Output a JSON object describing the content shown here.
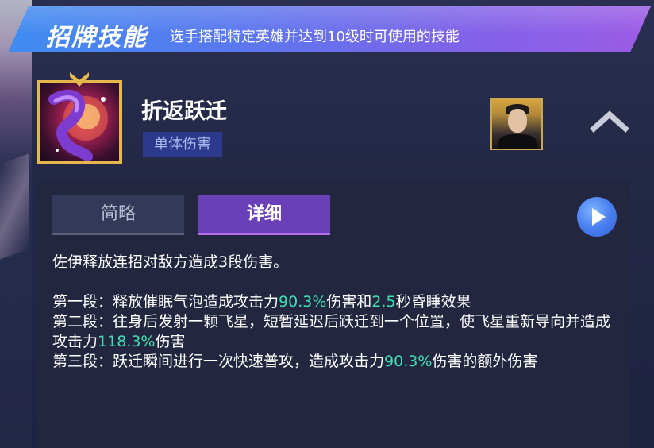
{
  "banner": {
    "title": "招牌技能",
    "subtitle": "选手搭配特定英雄并达到10级时可使用的技能"
  },
  "skill": {
    "icon": "skill-icon-purple-swirl",
    "name": "折返跃迁",
    "tag": "单体伤害"
  },
  "hero_avatar": "player-avatar",
  "collapse_icon": "chevron-up-icon",
  "tabs": [
    {
      "label": "简略",
      "active": false
    },
    {
      "label": "详细",
      "active": true
    }
  ],
  "play_icon": "play-icon",
  "colors": {
    "highlight": "#3ee0b4",
    "active_tab": "#6a40b8",
    "banner_start": "#3f8cf0",
    "banner_end": "#9c5be6"
  },
  "description": {
    "intro": "佐伊释放连招对敌方造成3段伤害。",
    "line1": {
      "prefix": "第一段：释放催眠气泡造成攻击力",
      "v1": "90.3%",
      "mid": "伤害和",
      "v2": "2.5",
      "suffix": "秒昏睡效果"
    },
    "line2": {
      "prefix": "第二段：往身后发射一颗飞星，短暂延迟后跃迁到一个位置，使飞星重新导向并造成攻击力",
      "v1": "118.3%",
      "suffix": "伤害"
    },
    "line3": {
      "prefix": "第三段：跃迁瞬间进行一次快速普攻，造成攻击力",
      "v1": "90.3%",
      "suffix": "伤害的额外伤害"
    }
  }
}
